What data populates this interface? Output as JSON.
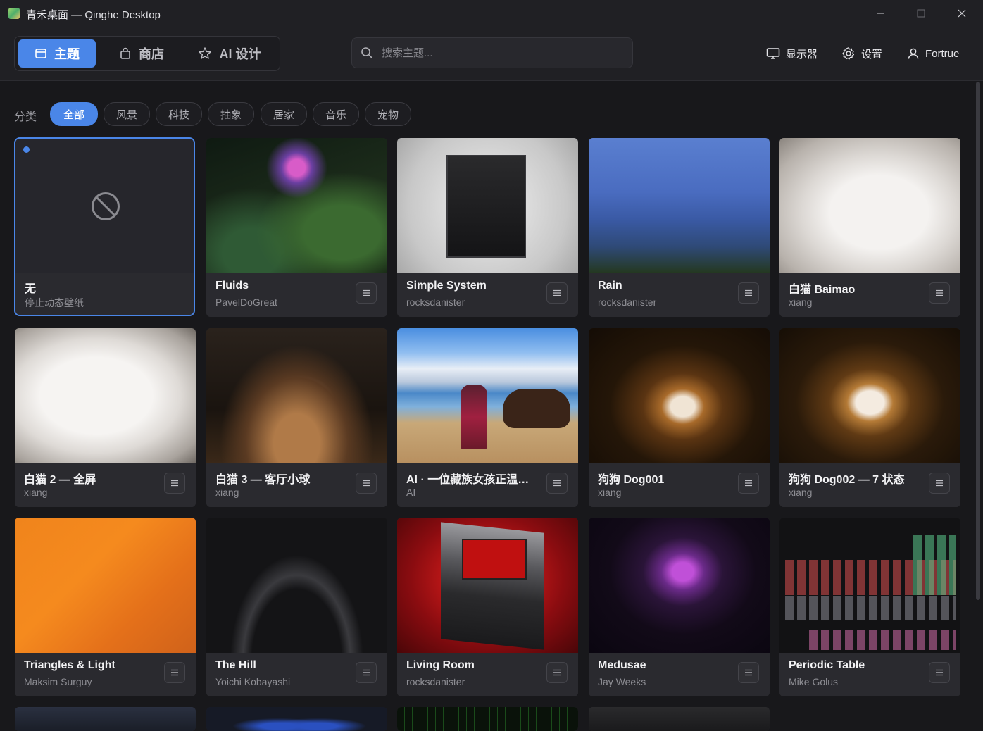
{
  "window": {
    "title": "青禾桌面 — Qinghe Desktop"
  },
  "nav": {
    "tabs": [
      {
        "label": "主题",
        "icon": "window-icon",
        "active": true
      },
      {
        "label": "商店",
        "icon": "shopping-bag-icon",
        "active": false
      },
      {
        "label": "AI 设计",
        "icon": "star-icon",
        "active": false
      }
    ]
  },
  "search": {
    "placeholder": "搜索主题..."
  },
  "header_actions": {
    "monitor_label": "显示器",
    "settings_label": "设置",
    "user_label": "Fortrue"
  },
  "categories": {
    "label": "分类",
    "items": [
      "全部",
      "风景",
      "科技",
      "抽象",
      "居家",
      "音乐",
      "宠物"
    ],
    "selected": "全部"
  },
  "themes": [
    {
      "title": "无",
      "author": "停止动态壁纸",
      "selected": true
    },
    {
      "title": "Fluids",
      "author": "PavelDoGreat"
    },
    {
      "title": "Simple System",
      "author": "rocksdanister"
    },
    {
      "title": "Rain",
      "author": "rocksdanister"
    },
    {
      "title": "白猫 Baimao",
      "author": "xiang"
    },
    {
      "title": "白猫 2 — 全屏",
      "author": "xiang"
    },
    {
      "title": "白猫 3 — 客厅小球",
      "author": "xiang"
    },
    {
      "title": "AI · 一位藏族女孩正温柔地牵着牦牛",
      "author": "AI"
    },
    {
      "title": "狗狗 Dog001",
      "author": "xiang"
    },
    {
      "title": "狗狗 Dog002 — 7 状态",
      "author": "xiang"
    },
    {
      "title": "Triangles & Light",
      "author": "Maksim Surguy"
    },
    {
      "title": "The Hill",
      "author": "Yoichi Kobayashi"
    },
    {
      "title": "Living Room",
      "author": "rocksdanister"
    },
    {
      "title": "Medusae",
      "author": "Jay Weeks"
    },
    {
      "title": "Periodic Table",
      "author": "Mike Golus"
    }
  ],
  "colors": {
    "accent": "#4a86e8",
    "background": "#18181b",
    "card": "#2a2a2f"
  }
}
